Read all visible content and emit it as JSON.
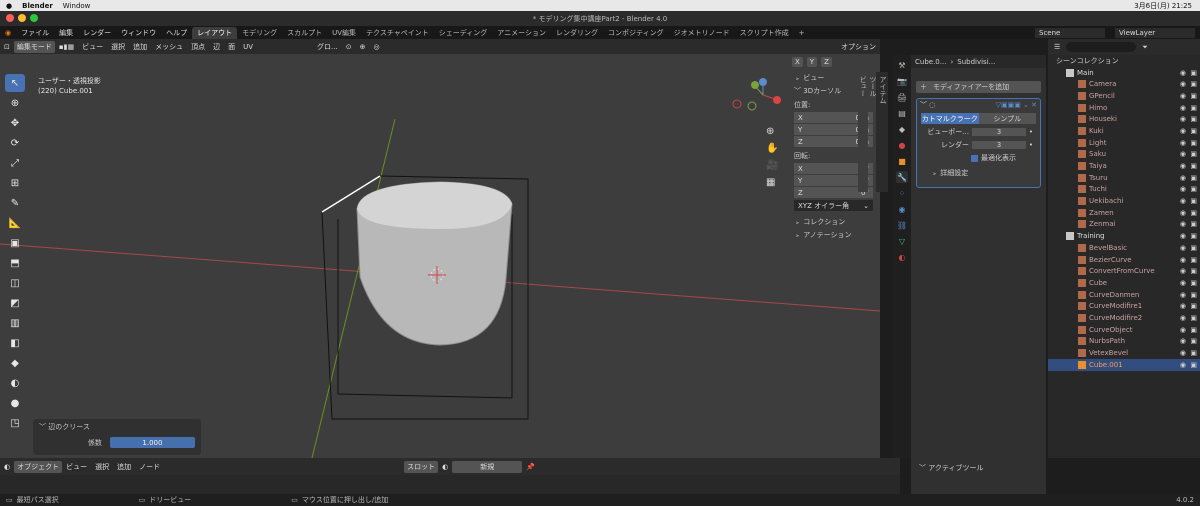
{
  "mac_bar": {
    "app": "Blender",
    "menu": "Window",
    "clock": "3月6日(月) 21:25"
  },
  "window_title": "* モデリング集中講座Part2 - Blender 4.0",
  "top_menu": [
    "ファイル",
    "編集",
    "レンダー",
    "ウィンドウ",
    "ヘルプ"
  ],
  "workspace_tabs": [
    "レイアウト",
    "モデリング",
    "スカルプト",
    "UV編集",
    "テクスチャペイント",
    "シェーディング",
    "アニメーション",
    "レンダリング",
    "コンポジティング",
    "ジオメトリノード",
    "スクリプト作成"
  ],
  "scene": "Scene",
  "view_layer": "ViewLayer",
  "viewport_header": {
    "mode": "編集モード",
    "menus": [
      "ビュー",
      "選択",
      "追加",
      "メッシュ",
      "頂点",
      "辺",
      "面",
      "UV"
    ],
    "orientation": "グロ...",
    "options": "オプション",
    "axes": [
      "X",
      "Y",
      "Z"
    ]
  },
  "viewport_info": {
    "view_name": "ユーザー・透視投影",
    "object": "(220) Cube.001"
  },
  "npanel": {
    "view_label": "ビュー",
    "cursor_label": "3Dカーソル",
    "location_label": "位置:",
    "loc": [
      {
        "axis": "X",
        "val": "0 m"
      },
      {
        "axis": "Y",
        "val": "0 m"
      },
      {
        "axis": "Z",
        "val": "0 m"
      }
    ],
    "rotation_label": "回転:",
    "rot": [
      {
        "axis": "X",
        "val": "0°"
      },
      {
        "axis": "Y",
        "val": "0°"
      },
      {
        "axis": "Z",
        "val": "0°"
      }
    ],
    "euler": "XYZ オイラー角",
    "collection": "コレクション",
    "annotation": "アノテーション"
  },
  "vtabs": [
    "アイテム",
    "ツール",
    "ビュー"
  ],
  "props": {
    "object": "Cube.0...",
    "modifier": "Subdivisi...",
    "add_modifier": "モディファイアーを追加",
    "tab1": "カトマルクラーク",
    "tab2": "シンプル",
    "viewport_label": "ビューポー...",
    "viewport_val": "3",
    "render_label": "レンダー",
    "render_val": "3",
    "optimal": "最適化表示",
    "advanced": "詳細設定"
  },
  "outliner": {
    "header": "シーンコレクション",
    "rows": [
      {
        "name": "Main",
        "type": "collection"
      },
      {
        "name": "Camera",
        "type": "item"
      },
      {
        "name": "GPencil",
        "type": "item"
      },
      {
        "name": "Himo",
        "type": "item"
      },
      {
        "name": "Houseki",
        "type": "item"
      },
      {
        "name": "Kuki",
        "type": "item"
      },
      {
        "name": "Light",
        "type": "item"
      },
      {
        "name": "Saku",
        "type": "item"
      },
      {
        "name": "Taiya",
        "type": "item"
      },
      {
        "name": "Tsuru",
        "type": "item"
      },
      {
        "name": "Tuchi",
        "type": "item"
      },
      {
        "name": "Uekibachi",
        "type": "item"
      },
      {
        "name": "Zamen",
        "type": "item"
      },
      {
        "name": "Zenmai",
        "type": "item"
      },
      {
        "name": "Training",
        "type": "collection"
      },
      {
        "name": "BevelBasic",
        "type": "item"
      },
      {
        "name": "BezierCurve",
        "type": "item"
      },
      {
        "name": "ConvertFromCurve",
        "type": "item"
      },
      {
        "name": "Cube",
        "type": "item"
      },
      {
        "name": "CurveDanmen",
        "type": "item"
      },
      {
        "name": "CurveModifire1",
        "type": "item"
      },
      {
        "name": "CurveModifire2",
        "type": "item"
      },
      {
        "name": "CurveObject",
        "type": "item"
      },
      {
        "name": "NurbsPath",
        "type": "item"
      },
      {
        "name": "VetexBevel",
        "type": "item"
      },
      {
        "name": "Cube.001",
        "type": "active"
      }
    ]
  },
  "crease": {
    "title": "辺のクリース",
    "label": "係数",
    "value": "1.000"
  },
  "bottom_header": {
    "mode": "オブジェクト",
    "menus": [
      "ビュー",
      "選択",
      "追加",
      "ノード"
    ],
    "slot": "スロット",
    "new": "新規"
  },
  "active_tool": "アクティブツール",
  "status": {
    "left": "最短パス選択",
    "mid": "ドリービュー",
    "right": "マウス位置に押し出し/追加",
    "version": "4.0.2"
  },
  "colors": {
    "accent": "#4772b3",
    "viewport": "#3d3d3d",
    "panel": "#303030"
  }
}
